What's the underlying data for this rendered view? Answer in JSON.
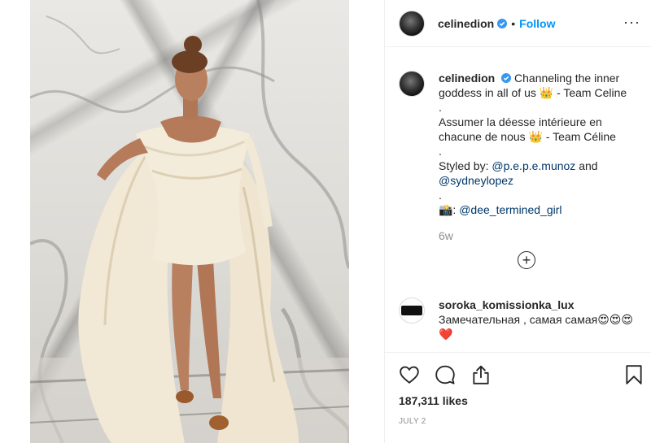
{
  "post": {
    "username": "celinedion",
    "follow_label": "Follow",
    "dot": "•",
    "more_label": "···"
  },
  "caption": {
    "username": "celinedion",
    "line1": "Channeling the inner goddess in all of us 👑 - Team Celine",
    "sep1": ".",
    "line2": "Assumer la déesse intérieure en chacune de nous 👑 - Team Céline",
    "sep2": ".",
    "styled_by": "Styled by: ",
    "mention1": "@p.e.p.e.munoz",
    "and": " and",
    "mention2": "@sydneylopez",
    "sep3": ".",
    "camera": "📸: ",
    "mention3": "@dee_termined_girl"
  },
  "time_ago": "6w",
  "load_more_symbol": "+",
  "comment": {
    "username": "soroka_komissionka_lux",
    "text": "Замечательная , самая самая😍😍😍❤️"
  },
  "likes": "187,311 likes",
  "date": "JULY 2",
  "icons": {
    "like": "heart-icon",
    "comment": "comment-icon",
    "share": "share-icon",
    "save": "bookmark-icon",
    "verified": "verified-badge-icon"
  },
  "colors": {
    "accent": "#0095f6",
    "verified": "#3897f0",
    "text": "#262626",
    "muted": "#8e8e8e"
  }
}
